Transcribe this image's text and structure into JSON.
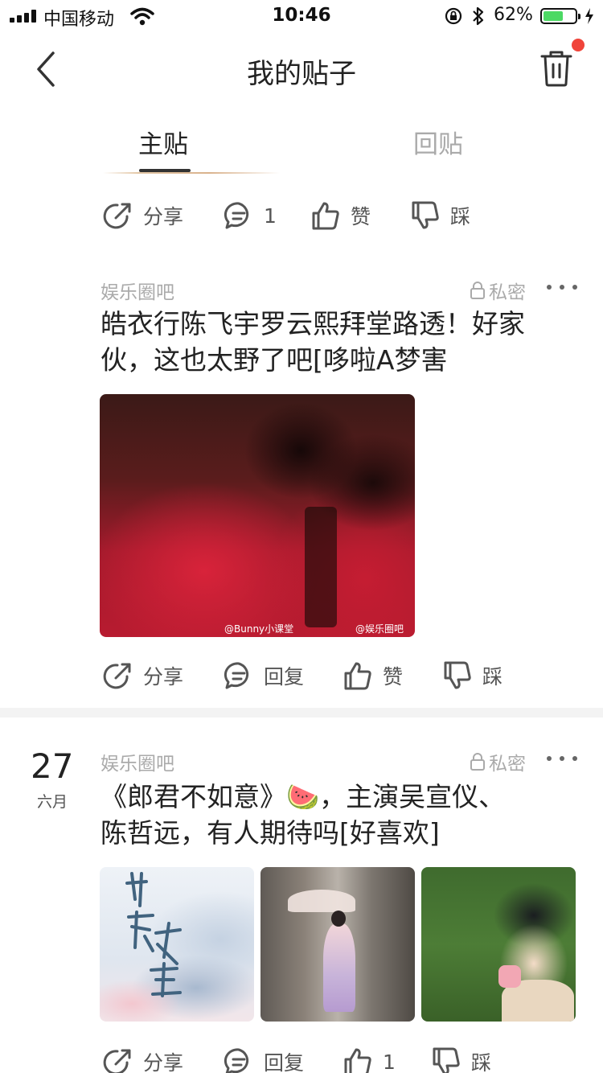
{
  "status": {
    "carrier": "中国移动",
    "time": "10:46",
    "battery_pct": "62%",
    "battery_level": 0.62
  },
  "nav": {
    "title": "我的贴子"
  },
  "tabs": {
    "main": "主贴",
    "reply": "回贴"
  },
  "top_actions": {
    "share": "分享",
    "comment": "1",
    "like": "赞",
    "dislike": "踩"
  },
  "posts": [
    {
      "source": "娱乐圈吧",
      "private": "私密",
      "title_line1": "皓衣行陈飞宇罗云熙拜堂路透！好家",
      "title_line2": "伙，这也太野了吧[哆啦A梦害",
      "watermark1": "@Bunny小课堂",
      "watermark2": "@娱乐圈吧",
      "actions": {
        "share": "分享",
        "reply": "回复",
        "like": "赞",
        "dislike": "踩"
      }
    },
    {
      "date_day": "27",
      "date_month": "六月",
      "source": "娱乐圈吧",
      "private": "私密",
      "title_line1": "《郎君不如意》🍉，主演吴宣仪、",
      "title_line2": "陈哲远，有人期待吗[好喜欢]",
      "actions": {
        "share": "分享",
        "reply": "回复",
        "like": "1",
        "dislike": "踩"
      }
    }
  ],
  "icons": {
    "back": "chevron-left-icon",
    "trash": "trash-icon",
    "share": "share-icon",
    "comment": "comment-icon",
    "like": "thumbs-up-icon",
    "dislike": "thumbs-down-icon",
    "lock": "lock-icon",
    "more": "more-dots-icon"
  },
  "colors": {
    "notification_dot": "#f0443a",
    "battery_fill": "#4cd964",
    "muted_text": "#aaaaaa"
  }
}
